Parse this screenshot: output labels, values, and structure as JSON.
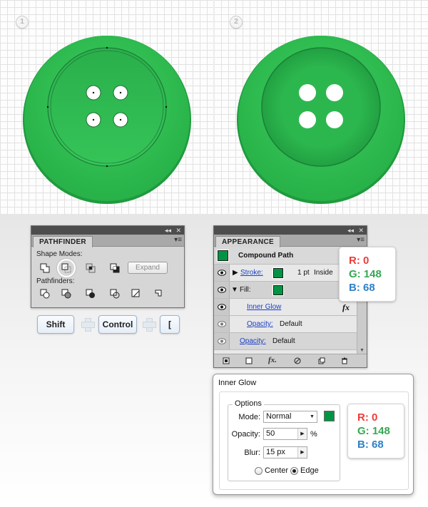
{
  "steps": [
    "1",
    "2"
  ],
  "colors": {
    "button_green": "#2ebd4f",
    "button_dark_green": "#16903a",
    "fill_color": "#009444"
  },
  "pathfinder_panel": {
    "tab": "PATHFINDER",
    "collapse_icon": "◂◂",
    "close_icon": "✕",
    "menu_icon": "▾≡",
    "shape_modes_label": "Shape Modes:",
    "pathfinders_label": "Pathfinders:",
    "expand_label": "Expand",
    "shape_mode_icons": [
      "unite-icon",
      "minus-front-icon",
      "intersect-icon",
      "exclude-icon"
    ],
    "pathfinder_icons": [
      "divide-icon",
      "trim-icon",
      "merge-icon",
      "crop-icon",
      "outline-icon",
      "minus-back-icon"
    ]
  },
  "shortcut": {
    "keys": [
      "Shift",
      "Control",
      "["
    ]
  },
  "appearance_panel": {
    "tab": "APPEARANCE",
    "object_label": "Compound Path",
    "stroke_label": "Stroke:",
    "stroke_weight": "1 pt",
    "stroke_align": "Inside",
    "fill_label": "Fill:",
    "effect_label": "Inner Glow",
    "fx_icon": "fx",
    "fill_opacity_label": "Opacity:",
    "fill_opacity_value": "Default",
    "object_opacity_label": "Opacity:",
    "object_opacity_value": "Default",
    "footer_fx": "fx."
  },
  "rgb_top": {
    "r": "R: 0",
    "g": "G: 148",
    "b": "B: 68"
  },
  "rgb_bottom": {
    "r": "R: 0",
    "g": "G: 148",
    "b": "B: 68"
  },
  "inner_glow_dialog": {
    "title": "Inner Glow",
    "options_legend": "Options",
    "mode_label": "Mode:",
    "mode_value": "Normal",
    "opacity_label": "Opacity:",
    "opacity_value": "50",
    "opacity_unit": "%",
    "blur_label": "Blur:",
    "blur_value": "15 px",
    "center_label": "Center",
    "edge_label": "Edge",
    "selected_option": "Edge"
  }
}
